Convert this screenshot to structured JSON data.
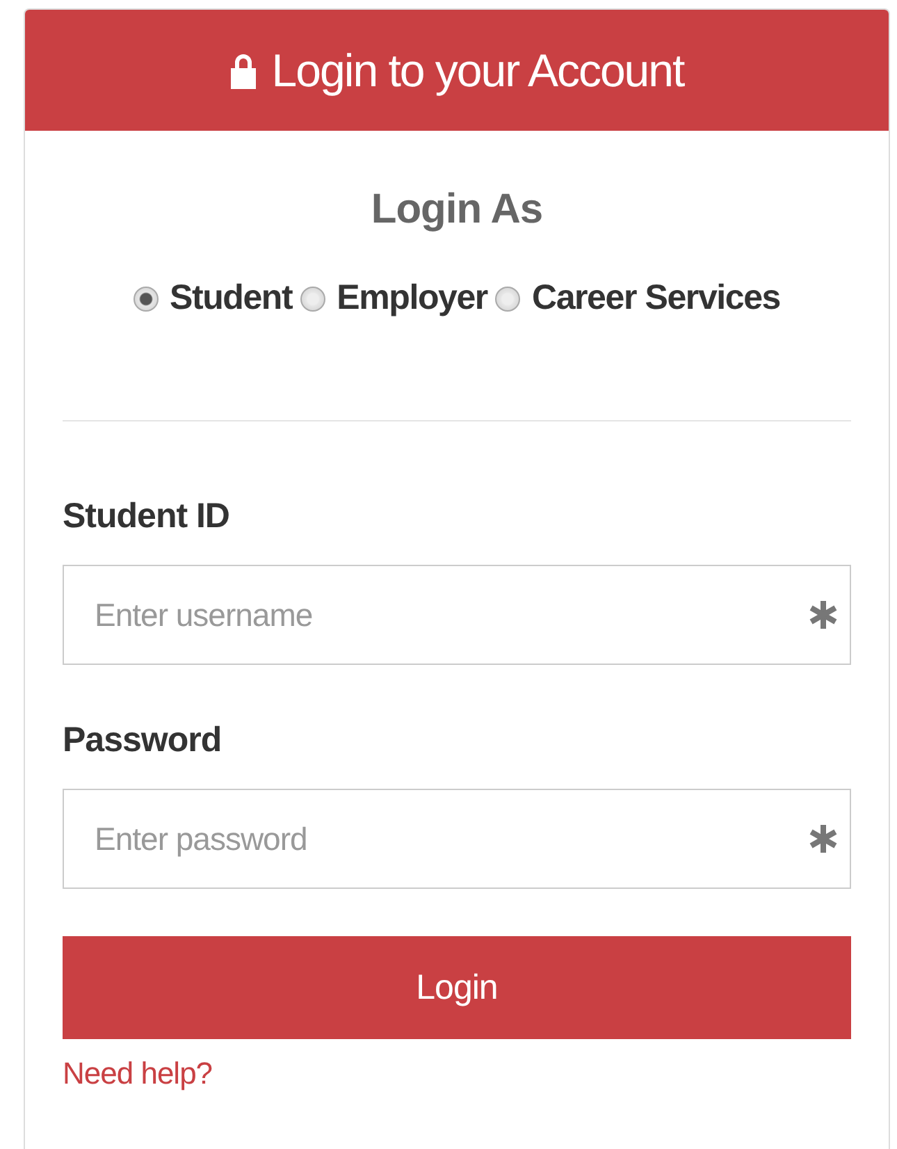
{
  "header": {
    "title": "Login to your Account"
  },
  "login_as": {
    "title": "Login As",
    "options": [
      {
        "label": "Student",
        "selected": true
      },
      {
        "label": "Employer",
        "selected": false
      },
      {
        "label": "Career Services",
        "selected": false
      }
    ]
  },
  "fields": [
    {
      "label": "Student ID",
      "placeholder": "Enter username",
      "required": true
    },
    {
      "label": "Password",
      "placeholder": "Enter password",
      "required": true
    }
  ],
  "submit": {
    "label": "Login"
  },
  "help_link": {
    "label": "Need help?"
  }
}
